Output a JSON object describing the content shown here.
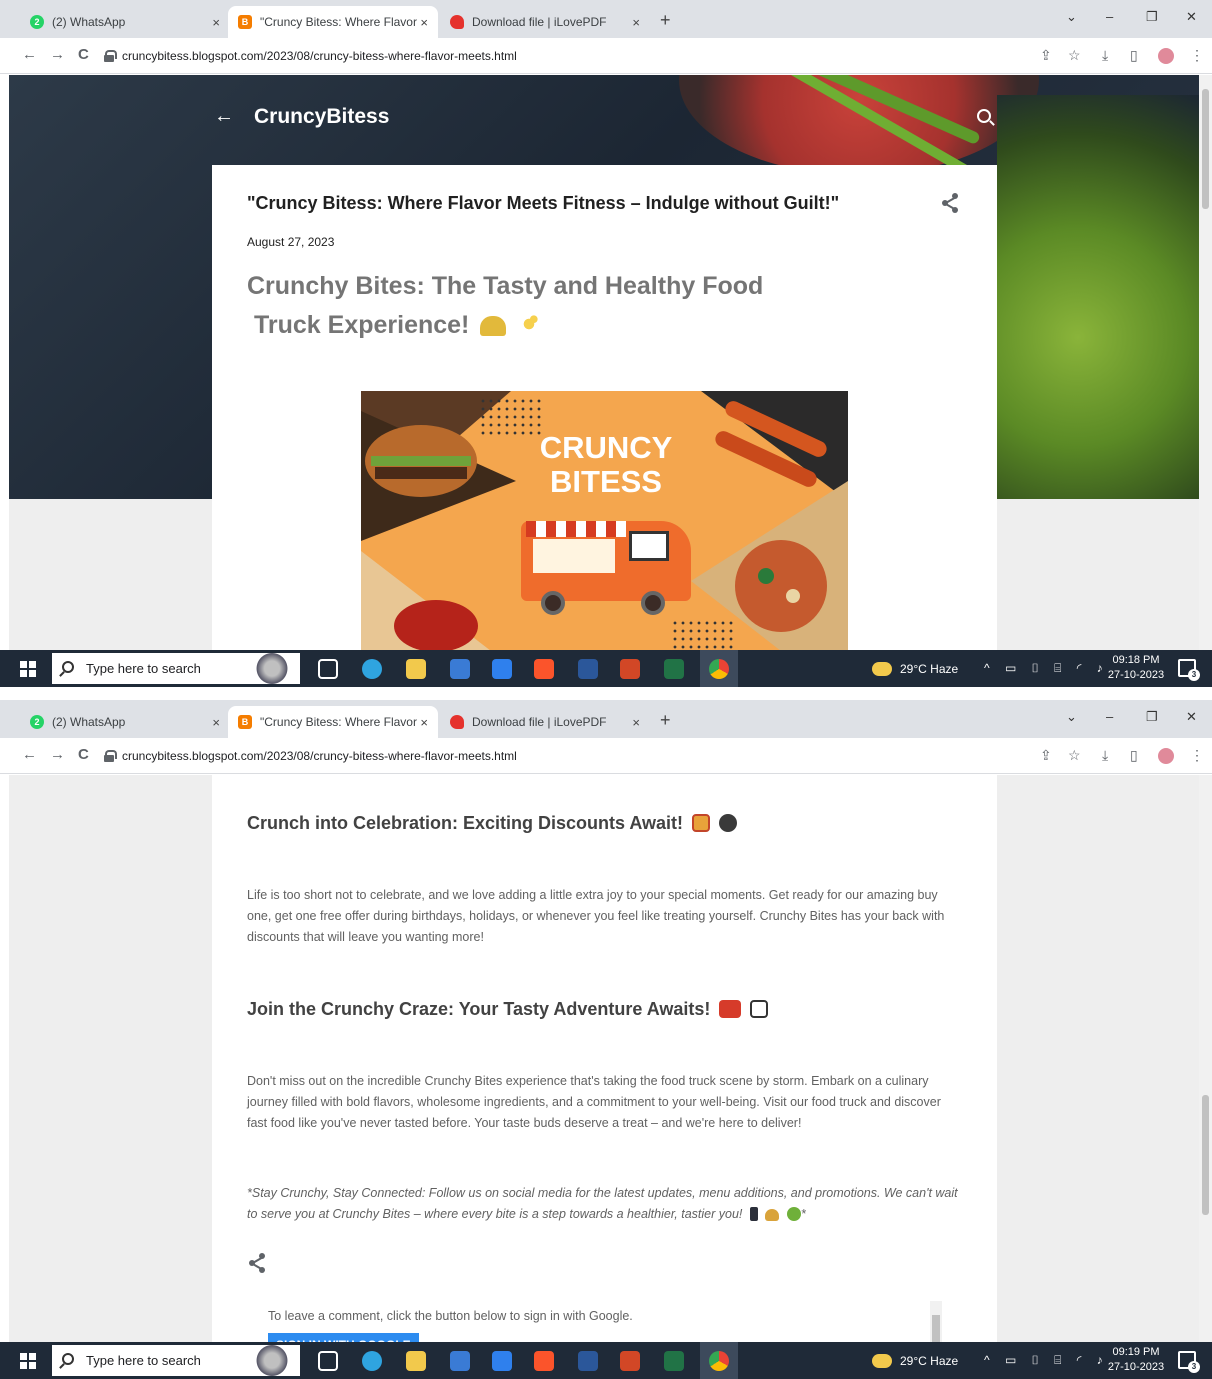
{
  "browser": {
    "tabs": [
      {
        "label": "(2) WhatsApp",
        "badge": "2",
        "color": "#25d366"
      },
      {
        "label": "\"Cruncy Bitess: Where Flavor Meets Fitness",
        "badge": "B",
        "color": "#f57d00"
      },
      {
        "label": "Download file | iLovePDF",
        "badge": "",
        "color": "#e5322d"
      }
    ],
    "url": "cruncybitess.blogspot.com/2023/08/cruncy-bitess-where-flavor-meets.html",
    "close_glyph": "×",
    "new_tab_glyph": "+"
  },
  "blog": {
    "name": "CruncyBitess",
    "post_title": "\"Cruncy Bitess: Where Flavor Meets Fitness – Indulge without Guilt!\"",
    "date": "August 27, 2023",
    "heading_line1": "Crunchy Bites: The Tasty and Healthy Food",
    "heading_line2": "Truck Experience!",
    "banner_line1": "CRUNCY",
    "banner_line2": "BITESS"
  },
  "post": {
    "h_discounts": "Crunch into Celebration: Exciting Discounts Await!",
    "p_discounts": "Life is too short not to celebrate, and we love adding a little extra joy to your special moments. Get ready for our amazing buy one, get one free offer during birthdays, holidays, or whenever you feel like treating yourself. Crunchy Bites has your back with discounts that will leave you wanting more!",
    "h_join": "Join the Crunchy Craze: Your Tasty Adventure Awaits!",
    "p_join": "Don't miss out on the incredible Crunchy Bites experience that's taking the food truck scene by storm. Embark on a culinary journey filled with bold flavors, wholesome ingredients, and a commitment to your well-being. Visit our food truck and discover fast food like you've never tasted before. Your taste buds deserve a treat – and we're here to deliver!",
    "p_connected": "*Stay Crunchy, Stay Connected: Follow us on social media for the latest updates, menu additions, and promotions. We can't wait to serve you at Crunchy Bites – where every bite is a step towards a healthier, tastier you!",
    "p_connected_tail": "*",
    "comment_prompt": "To leave a comment, click the button below to sign in with Google.",
    "signin_label": "SIGN IN WITH GOOGLE"
  },
  "taskbar": {
    "search_placeholder": "Type here to search",
    "weather": "29°C  Haze",
    "time1": "09:18 PM",
    "time2": "09:19 PM",
    "date": "27-10-2023",
    "notifications": "3"
  },
  "icons": {
    "back": "←",
    "forward": "→",
    "reload": "C",
    "share": "share-icon",
    "bookmark": "☆",
    "download": "⤓",
    "menu": "⋮",
    "minimize": "–",
    "restore": "❐",
    "close": "✕",
    "chevron": "⌄"
  }
}
